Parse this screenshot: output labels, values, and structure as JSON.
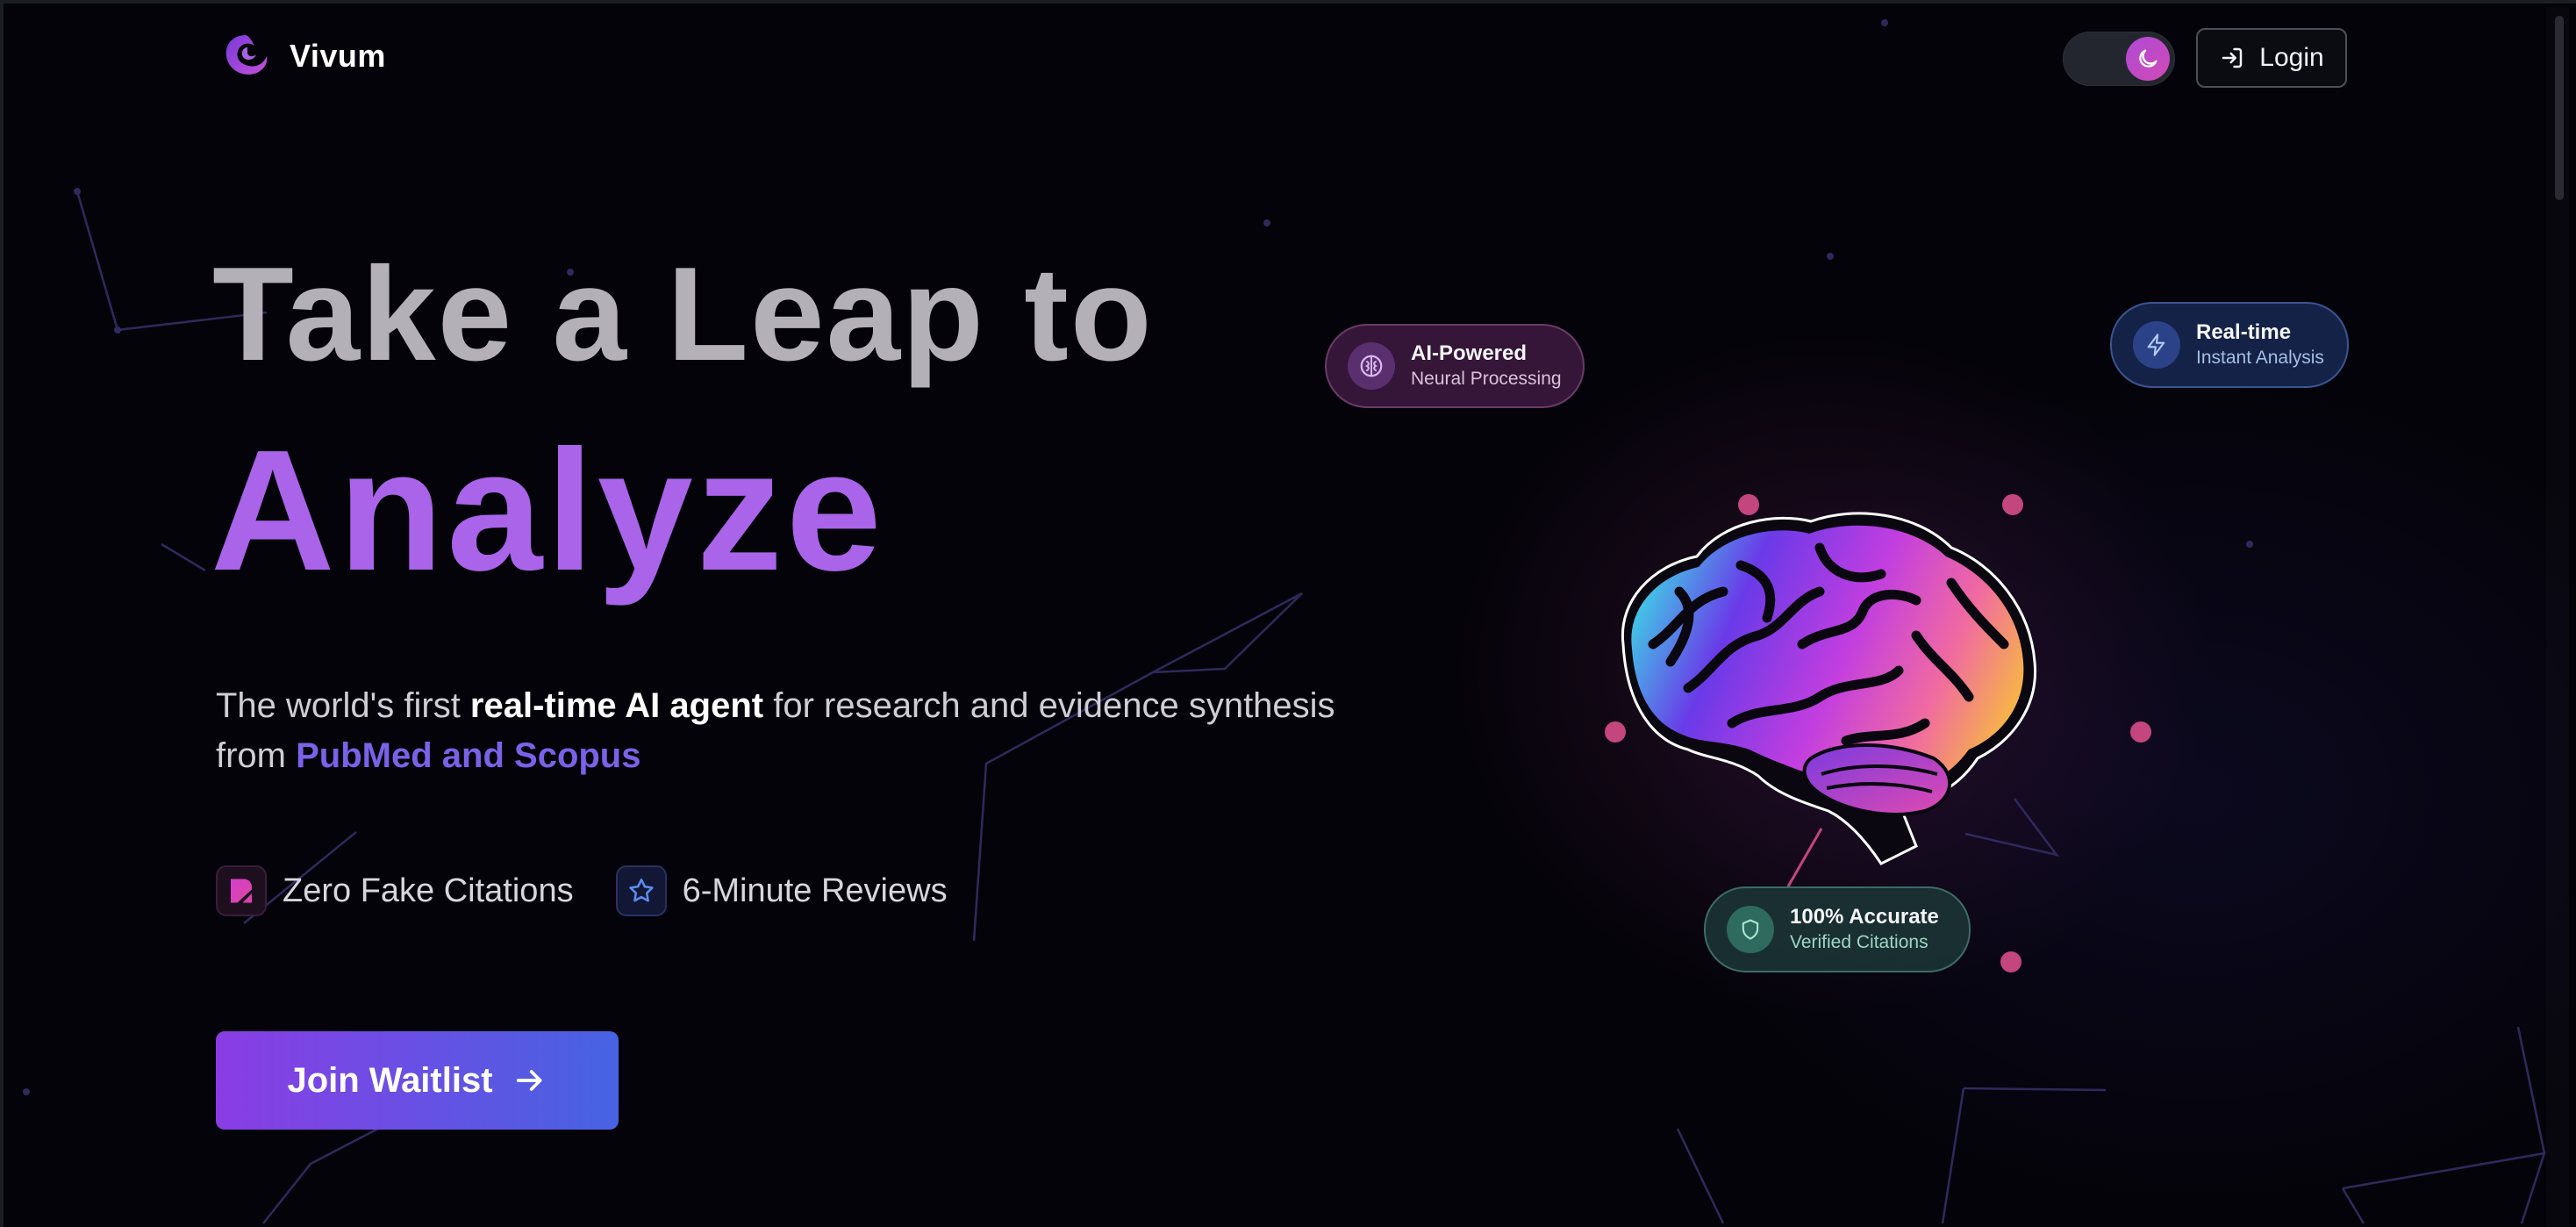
{
  "app": {
    "name": "Vivum"
  },
  "header": {
    "theme_toggle": {
      "icon": "moon-icon",
      "state": "dark"
    },
    "login_label": "Login"
  },
  "hero": {
    "line1": "Take a Leap to",
    "line2": "Analyze",
    "subtitle": {
      "part1": "The world's first ",
      "bold": "real-time AI agent",
      "part2": " for research and evidence synthesis from ",
      "highlight": "PubMed and Scopus"
    },
    "features": [
      {
        "label": "Zero Fake Citations",
        "icon": "citation-icon"
      },
      {
        "label": "6-Minute Reviews",
        "icon": "star-icon"
      }
    ],
    "cta_label": "Join Waitlist"
  },
  "badges": {
    "ai": {
      "title": "AI-Powered",
      "subtitle": "Neural Processing",
      "icon": "brain-icon"
    },
    "realtime": {
      "title": "Real-time",
      "subtitle": "Instant Analysis",
      "icon": "lightning-icon"
    },
    "accurate": {
      "title": "100% Accurate",
      "subtitle": "Verified Citations",
      "icon": "shield-icon"
    }
  },
  "colors": {
    "accent_purple": "#a964ea",
    "highlight_indigo": "#7a62e8",
    "button_gradient_start": "#8a3de4",
    "button_gradient_end": "#4663e3",
    "background": "#040309"
  }
}
